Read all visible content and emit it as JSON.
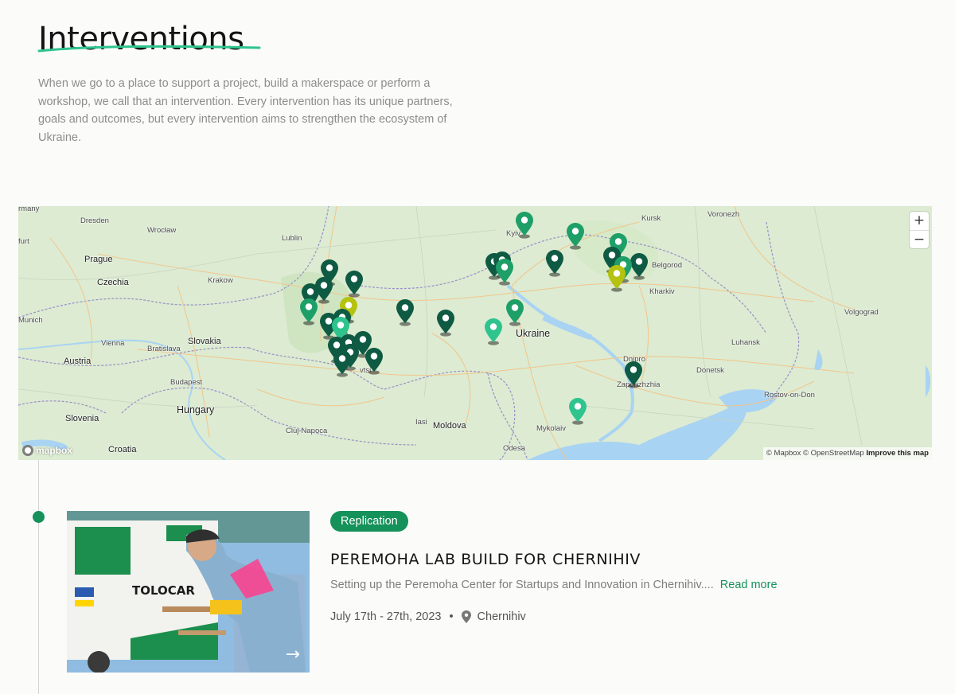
{
  "page": {
    "title": "Interventions",
    "intro": "When we go to a place to support a project, build a makerspace or perform a workshop, we call that an intervention. Every intervention has its unique partners, goals and outcomes, but every intervention aims to strengthen the ecosystem of Ukraine."
  },
  "map": {
    "zoom_in": "+",
    "zoom_out": "−",
    "logo": "mapbox",
    "attribution": "© Mapbox © OpenStreetMap",
    "improve": "Improve this map",
    "labels": {
      "germany": "rmany",
      "dresden": "Dresden",
      "wroclaw": "Wrocław",
      "lublin": "Lublin",
      "kursk": "Kursk",
      "voronezh": "Voronezh",
      "furt": "furt",
      "prague": "Prague",
      "czechia": "Czechia",
      "krakow": "Krakow",
      "belgorod": "Belgorod",
      "kharkiv": "Kharkiv",
      "munich": "Munich",
      "vienna": "Vienna",
      "bratislava": "Bratislava",
      "slovakia": "Slovakia",
      "austria": "Austria",
      "ukraine": "Ukraine",
      "volgograd": "Volgograd",
      "luhansk": "Luhansk",
      "dnipro": "Dnipro",
      "donetsk": "Donetsk",
      "zaporizhzhia": "Zaporizhzhia",
      "budapest": "Budapest",
      "hungary": "Hungary",
      "rostov": "Rostov-on-Don",
      "slovenia": "Slovenia",
      "cluj": "Cluj-Napoca",
      "iasi": "Iasi",
      "moldova": "Moldova",
      "mykolaiv": "Mykolaiv",
      "croatia": "Croatia",
      "odesa": "Odesa",
      "kyiv": "Kyiv",
      "chernivtsi": "vtsi"
    },
    "colors": {
      "land": "#dcebd2",
      "water": "#a9d3f3",
      "pin_dark": "#0f5a43",
      "pin_mid": "#1e9f68",
      "pin_light": "#2fc48d",
      "pin_yellow": "#b5c20f"
    }
  },
  "intervention": {
    "badge": "Replication",
    "title": "PEREMOHA LAB BUILD FOR CHERNIHIV",
    "description": "Setting up the Peremoha Center for Startups and Innovation in Chernihiv....",
    "read_more": "Read more",
    "dates": "July 17th - 27th, 2023",
    "separator": "•",
    "location": "Chernihiv",
    "image_text": "TOLOCAR",
    "arrow_icon": "arrow-right-icon"
  },
  "colors": {
    "accent": "#15915a",
    "title": "#141414",
    "muted": "#8d8d8d"
  }
}
